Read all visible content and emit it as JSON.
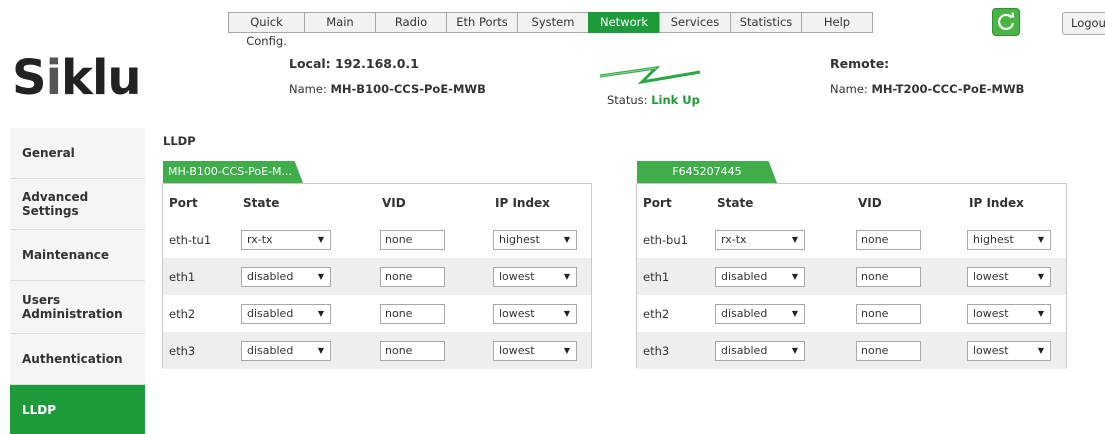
{
  "nav": {
    "tabs": [
      {
        "label": "Quick Config.",
        "active": false
      },
      {
        "label": "Main",
        "active": false
      },
      {
        "label": "Radio",
        "active": false
      },
      {
        "label": "Eth Ports",
        "active": false
      },
      {
        "label": "System",
        "active": false
      },
      {
        "label": "Network",
        "active": true
      },
      {
        "label": "Services",
        "active": false
      },
      {
        "label": "Statistics",
        "active": false
      },
      {
        "label": "Help",
        "active": false
      }
    ],
    "refresh_icon": "refresh-icon",
    "logout_label": "Logout"
  },
  "logo": {
    "text_start": "S",
    "text_i": "i",
    "text_end": "klu"
  },
  "header": {
    "local_label": "Local: 192.168.0.1",
    "local_name_label": "Name:",
    "local_name": "MH-B100-CCS-PoE-MWB",
    "status_label": "Status:",
    "status_value": "Link Up",
    "remote_label": "Remote:",
    "remote_name_label": "Name:",
    "remote_name": "MH-T200-CCC-PoE-MWB",
    "link_icon": "lightning-link-icon"
  },
  "sidebar": {
    "items": [
      {
        "label": "General",
        "active": false
      },
      {
        "label": "Advanced Settings",
        "active": false
      },
      {
        "label": "Maintenance",
        "active": false
      },
      {
        "label": "Users Administration",
        "active": false
      },
      {
        "label": "Authentication",
        "active": false
      },
      {
        "label": "LLDP",
        "active": true
      }
    ]
  },
  "section": {
    "title": "LLDP"
  },
  "columns": [
    "Port",
    "State",
    "VID",
    "IP Index"
  ],
  "panels": [
    {
      "tab_label": "MH-B100-CCS-PoE-M...",
      "rows": [
        {
          "port": "eth-tu1",
          "state": "rx-tx",
          "vid": "none",
          "ip_index": "highest"
        },
        {
          "port": "eth1",
          "state": "disabled",
          "vid": "none",
          "ip_index": "lowest"
        },
        {
          "port": "eth2",
          "state": "disabled",
          "vid": "none",
          "ip_index": "lowest"
        },
        {
          "port": "eth3",
          "state": "disabled",
          "vid": "none",
          "ip_index": "lowest"
        }
      ]
    },
    {
      "tab_label": "F645207445",
      "rows": [
        {
          "port": "eth-bu1",
          "state": "rx-tx",
          "vid": "none",
          "ip_index": "highest"
        },
        {
          "port": "eth1",
          "state": "disabled",
          "vid": "none",
          "ip_index": "lowest"
        },
        {
          "port": "eth2",
          "state": "disabled",
          "vid": "none",
          "ip_index": "lowest"
        },
        {
          "port": "eth3",
          "state": "disabled",
          "vid": "none",
          "ip_index": "lowest"
        }
      ]
    }
  ],
  "colors": {
    "brand_green": "#1d9b3a",
    "tab_green": "#3fae4a",
    "row_alt": "#eeeeee"
  }
}
